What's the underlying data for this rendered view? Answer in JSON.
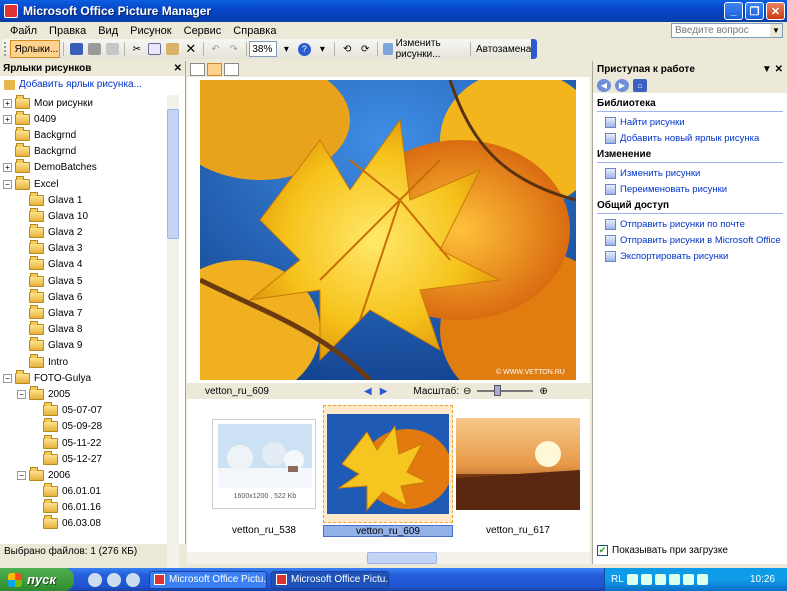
{
  "window": {
    "title": "Microsoft Office Picture Manager"
  },
  "menu": [
    {
      "label": "Файл"
    },
    {
      "label": "Правка"
    },
    {
      "label": "Вид"
    },
    {
      "label": "Рисунок"
    },
    {
      "label": "Сервис"
    },
    {
      "label": "Справка"
    }
  ],
  "help": {
    "placeholder": "Введите вопрос"
  },
  "toolbar": {
    "shortcuts_label": "Ярлыки...",
    "zoom_value": "38%",
    "edit_pictures_label": "Изменить рисунки...",
    "autocorrect_label": "Автозамена"
  },
  "left_pane": {
    "title": "Ярлыки рисунков",
    "add_shortcut": "Добавить ярлык рисунка...",
    "tree": [
      {
        "label": "Мои рисунки",
        "depth": 0,
        "expander": "+",
        "selected": true
      },
      {
        "label": "0409",
        "depth": 0,
        "expander": "+"
      },
      {
        "label": "Backgrnd",
        "depth": 0,
        "expander": ""
      },
      {
        "label": "Backgrnd",
        "depth": 0,
        "expander": ""
      },
      {
        "label": "DemoBatches",
        "depth": 0,
        "expander": "+"
      },
      {
        "label": "Excel",
        "depth": 0,
        "expander": "−"
      },
      {
        "label": "Glava 1",
        "depth": 1,
        "expander": ""
      },
      {
        "label": "Glava 10",
        "depth": 1,
        "expander": ""
      },
      {
        "label": "Glava 2",
        "depth": 1,
        "expander": ""
      },
      {
        "label": "Glava 3",
        "depth": 1,
        "expander": ""
      },
      {
        "label": "Glava 4",
        "depth": 1,
        "expander": ""
      },
      {
        "label": "Glava 5",
        "depth": 1,
        "expander": ""
      },
      {
        "label": "Glava 6",
        "depth": 1,
        "expander": ""
      },
      {
        "label": "Glava 7",
        "depth": 1,
        "expander": ""
      },
      {
        "label": "Glava 8",
        "depth": 1,
        "expander": ""
      },
      {
        "label": "Glava 9",
        "depth": 1,
        "expander": ""
      },
      {
        "label": "Intro",
        "depth": 1,
        "expander": ""
      },
      {
        "label": "FOTO-Gulya",
        "depth": 0,
        "expander": "−"
      },
      {
        "label": "2005",
        "depth": 1,
        "expander": "−"
      },
      {
        "label": "05-07-07",
        "depth": 2,
        "expander": ""
      },
      {
        "label": "05-09-28",
        "depth": 2,
        "expander": ""
      },
      {
        "label": "05-11-22",
        "depth": 2,
        "expander": ""
      },
      {
        "label": "05-12-27",
        "depth": 2,
        "expander": ""
      },
      {
        "label": "2006",
        "depth": 1,
        "expander": "−"
      },
      {
        "label": "06.01.01",
        "depth": 2,
        "expander": ""
      },
      {
        "label": "06.01.16",
        "depth": 2,
        "expander": ""
      },
      {
        "label": "06.03.08",
        "depth": 2,
        "expander": ""
      }
    ],
    "status": "Выбрано файлов: 1 (276 КБ)"
  },
  "viewer": {
    "current_file": "vetton_ru_609",
    "scale_label": "Масштаб:",
    "zoom_fraction": 0.35,
    "watermark": "© WWW.VETTON.RU",
    "thumbnails": [
      {
        "caption": "vetton_ru_538",
        "info": "1600x1200 , 522 Kb",
        "selected": false
      },
      {
        "caption": "vetton_ru_609",
        "info": "",
        "selected": true
      },
      {
        "caption": "vetton_ru_617",
        "info": "",
        "selected": false
      }
    ]
  },
  "task_pane": {
    "title": "Приступая к работе",
    "sections": [
      {
        "heading": "Библиотека",
        "links": [
          "Найти рисунки",
          "Добавить новый ярлык рисунка"
        ]
      },
      {
        "heading": "Изменение",
        "links": [
          "Изменить рисунки",
          "Переименовать рисунки"
        ]
      },
      {
        "heading": "Общий доступ",
        "links": [
          "Отправить рисунки по почте",
          "Отправить рисунки в Microsoft Office",
          "Экспортировать рисунки"
        ]
      }
    ],
    "show_on_load": "Показывать при загрузке"
  },
  "taskbar": {
    "start": "пуск",
    "tasks": [
      {
        "label": "Microsoft Office Pictu...",
        "active": false
      },
      {
        "label": "Microsoft Office Pictu...",
        "active": true
      }
    ],
    "lang": "RL",
    "clock": "10:26"
  }
}
